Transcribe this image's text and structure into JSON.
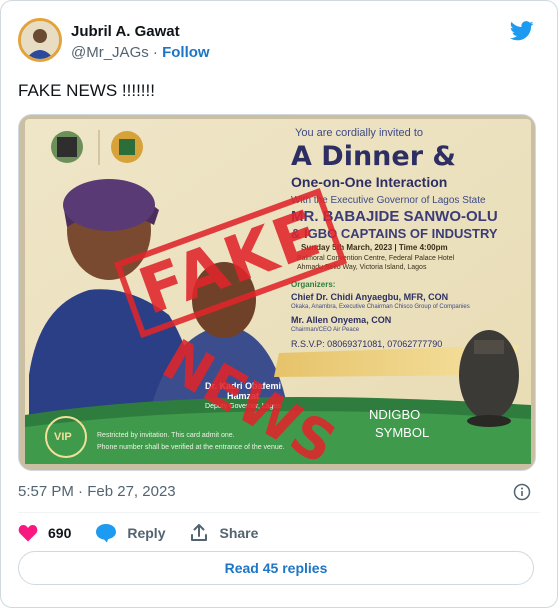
{
  "author": {
    "name": "Jubril A. Gawat",
    "handle": "@Mr_JAGs",
    "separator": "·",
    "follow_label": "Follow"
  },
  "tweet": {
    "text": "FAKE NEWS !!!!!!!"
  },
  "media": {
    "invite_line": "You are cordially invited to",
    "headline": "A Dinner &",
    "subheadline": "One-on-One Interaction",
    "with_line": "With the Executive Governor of Lagos State",
    "guest1": "MR. BABAJIDE SANWO-OLU",
    "guest2": "& IGBO CAPTAINS OF INDUSTRY",
    "date_line": "Sunday 5th March, 2023 | Time 4:00pm",
    "venue1": "Balmoral Convention Centre, Federal Palace Hotel",
    "venue2": "Ahmadu Bello Way, Victoria Island, Lagos",
    "organizers_label": "Organizers:",
    "org1": "Chief Dr. Chidi Anyaegbu, MFR, CON",
    "org1_desc": "Okaka, Anambra, Executive Chairman Chisco Group of Companies",
    "org2": "Mr. Allen Onyema, CON",
    "org2_desc": "Chairman/CEO Air Peace",
    "rsvp": "R.S.V.P: 08069371081, 07062777790",
    "deputy_name": "Dr. Kadri Obafemi Hamzat",
    "deputy_title": "Deputy Governor, Lagos",
    "symbol1": "NDIGBO",
    "symbol2": "SYMBOL",
    "vip": "VIP",
    "restricted1": "Restricted by invitation. This card admit one.",
    "restricted2": "Phone number shall be verified at the entrance of the venue.",
    "stamp1": "FAKE",
    "stamp2": "NEWS"
  },
  "meta": {
    "time": "5:57 PM",
    "separator": "·",
    "date": "Feb 27, 2023"
  },
  "actions": {
    "likes_count": "690",
    "reply_label": "Reply",
    "share_label": "Share"
  },
  "read_replies_label": "Read 45 replies",
  "colors": {
    "accent": "#1d75c6",
    "twitter_blue": "#1d9bf0",
    "like": "#f91880",
    "stamp": "#e0252b"
  }
}
